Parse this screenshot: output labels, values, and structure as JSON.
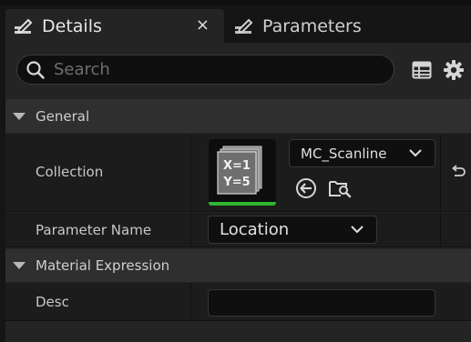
{
  "tabs": [
    {
      "label": "Details",
      "icon": "pencil-doc-icon",
      "active": true,
      "close": "×"
    },
    {
      "label": "Parameters",
      "icon": "pencil-doc-icon",
      "active": false
    }
  ],
  "search": {
    "placeholder": "Search"
  },
  "toolbar": {
    "icons": [
      "table-view-icon",
      "gear-icon"
    ]
  },
  "categories": [
    {
      "label": "General",
      "rows": [
        {
          "label": "Collection",
          "asset_thumbnail_text": [
            "X=1",
            "Y=5"
          ],
          "value": "MC_Scanline",
          "actions": [
            "use-selected-asset-icon",
            "browse-asset-icon"
          ],
          "reset_icon": "reset-arrow-icon"
        },
        {
          "label": "Parameter Name",
          "value": "Location"
        }
      ]
    },
    {
      "label": "Material Expression",
      "rows": [
        {
          "label": "Desc",
          "value": ""
        }
      ]
    }
  ],
  "colors": {
    "accent_green": "#2fb52f",
    "panel": "#242424",
    "field": "#0f0f0f"
  }
}
